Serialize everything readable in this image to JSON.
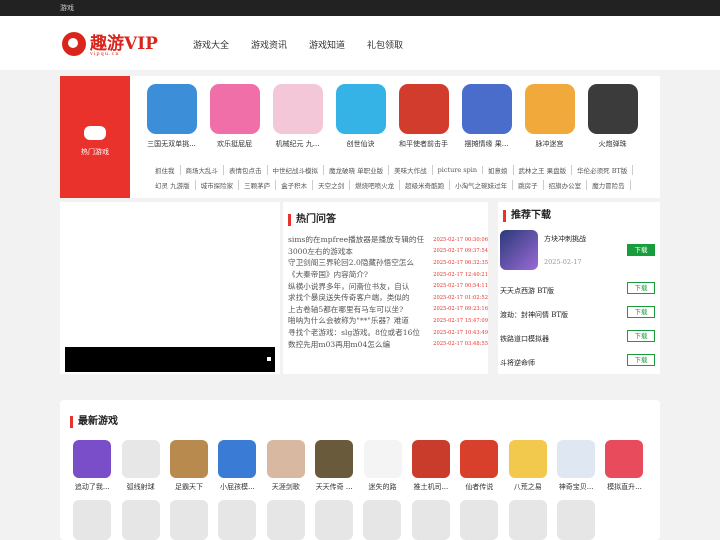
{
  "topbar": {
    "text": "游戏"
  },
  "logo": {
    "text": "趣游VIP",
    "sub": "vipqu.cn"
  },
  "nav": [
    "游戏大全",
    "游戏资讯",
    "游戏知道",
    "礼包领取"
  ],
  "hot": {
    "label": "热门游戏",
    "games": [
      {
        "name": "三国无双单挑...",
        "color": "#3d8ed8"
      },
      {
        "name": "欢乐挺屁屁",
        "color": "#f06fa8"
      },
      {
        "name": "机械纪元 九...",
        "color": "#f3c7d8"
      },
      {
        "name": "创世仙诀",
        "color": "#36b3e6"
      },
      {
        "name": "和平使者前击手",
        "color": "#d23c2c"
      },
      {
        "name": "摆摊情缘 果...",
        "color": "#4a6dcc"
      },
      {
        "name": "脉冲迷宫",
        "color": "#f2a93b"
      },
      {
        "name": "火炮弹珠",
        "color": "#3b3b3b"
      }
    ],
    "tag_rows": [
      [
        "抓住我",
        "商场大乱斗",
        "表情包点击",
        "中世纪战斗模拟",
        "魔龙破晓 单职业版",
        "美味大作战",
        "picture spin",
        "如意娘",
        "武林之王 果盘版",
        "华伦必须死 BT版"
      ],
      [
        "幻灵 九游版",
        "城市探险家",
        "三颗茅庐",
        "盒子积木",
        "天空之剑",
        "燃烧吧喷火龙",
        "超级米奇酷跑",
        "小淘气之碗妹过年",
        "跳房子",
        "招旗办公室",
        "魔力冒险岛"
      ]
    ]
  },
  "qa": {
    "title": "热门问答",
    "items": [
      {
        "text": "sims的在mpfree播放器是播放专辑的任",
        "date": "2025-02-17 00:30:06"
      },
      {
        "text": "3000左右的游戏本",
        "date": "2025-02-17 09:37:54"
      },
      {
        "text": "守卫剑阁三界轮回2.0隐藏孙悟空怎么",
        "date": "2025-02-17 06:32:35"
      },
      {
        "text": "《大秦帝国》内容简介?",
        "date": "2025-02-17 12:40:21"
      },
      {
        "text": "纵横小说界多年，问斋位书友，自认",
        "date": "2025-02-17 00:54:11"
      },
      {
        "text": "求找个暴戾送失传奇客户端，类似的",
        "date": "2025-02-17 01:02:52"
      },
      {
        "text": "上古卷轴5都在哪里有马车可以坐?",
        "date": "2025-02-17 09:23:16"
      },
      {
        "text": "啪呐为什么会被称为\"**\"乐器？难道",
        "date": "2025-02-17 15:47:09"
      },
      {
        "text": "寻找个老游戏：slg游戏。8位或者16位",
        "date": "2025-02-17 10:43:49"
      },
      {
        "text": "数控先用m03再用m04怎么编",
        "date": "2025-02-17 03:48:55"
      }
    ]
  },
  "recommend": {
    "title": "推荐下载",
    "top": {
      "name": "方块冲刺挑战",
      "date": "2025-02-17",
      "btn": "下载"
    },
    "items": [
      {
        "name": "天天点西游 BT版",
        "btn": "下载"
      },
      {
        "name": "渡劫：封神问情 BT版",
        "btn": "下载"
      },
      {
        "name": "铁路道口模拟器",
        "btn": "下载"
      },
      {
        "name": "斗将逆命师",
        "btn": "下载"
      }
    ]
  },
  "newest": {
    "title": "最新游戏",
    "games": [
      {
        "name": "追动了我...",
        "color": "#7b4ec9"
      },
      {
        "name": "弧线射球",
        "color": "#e7e7e7"
      },
      {
        "name": "足霸天下",
        "color": "#b98a4e"
      },
      {
        "name": "小屁孩模...",
        "color": "#3a7bd5"
      },
      {
        "name": "天涯剑歌",
        "color": "#d8b8a0"
      },
      {
        "name": "天天传奇 ...",
        "color": "#6a5a3c"
      },
      {
        "name": "迷失的路",
        "color": "#f4f4f4"
      },
      {
        "name": "推土机司...",
        "color": "#c93b2b"
      },
      {
        "name": "仙者传说",
        "color": "#d9402c"
      },
      {
        "name": "八荒之易",
        "color": "#f2c94c"
      },
      {
        "name": "神奇宝贝...",
        "color": "#dfe7f2"
      },
      {
        "name": "模拟直升...",
        "color": "#e84b5b"
      }
    ]
  }
}
